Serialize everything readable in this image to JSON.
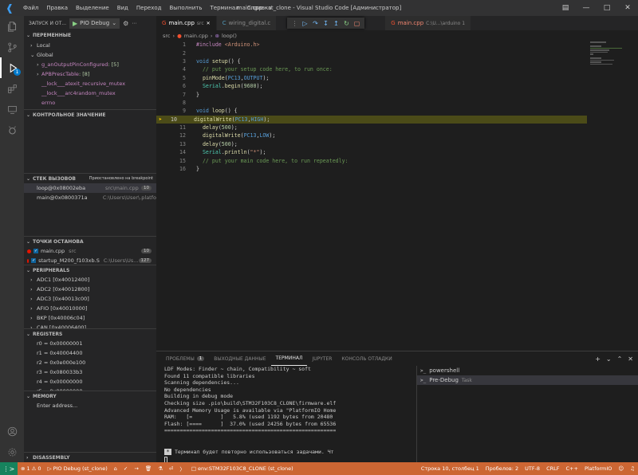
{
  "window": {
    "title": "main.cpp - st_clone - Visual Studio Code [Администратор]",
    "menu": [
      "Файл",
      "Правка",
      "Выделение",
      "Вид",
      "Переход",
      "Выполнить",
      "Терминал",
      "Справка"
    ]
  },
  "sidebar": {
    "run_label": "ЗАПУСК И ОТ...",
    "debug_config": "PIO Debug",
    "variables": {
      "title": "ПЕРЕМЕННЫЕ",
      "local": "Local",
      "global": "Global",
      "items": [
        {
          "name": "g_anOutputPinConfigured",
          "value": ": [5]"
        },
        {
          "name": "APBPrescTable",
          "value": ": [8]"
        },
        {
          "name": "__lock___atexit_recursive_mutex",
          "value": ""
        },
        {
          "name": "__lock___arc4random_mutex",
          "value": ""
        },
        {
          "name": "errno",
          "value": ""
        }
      ]
    },
    "watch": {
      "title": "КОНТРОЛЬНОЕ ЗНАЧЕНИЕ"
    },
    "callstack": {
      "title": "СТЕК ВЫЗОВОВ",
      "status": "Приостановлено на breakpoint",
      "frames": [
        {
          "fn": "loop@0x08002eba",
          "file": "src\\main.cpp",
          "line": "10"
        },
        {
          "fn": "main@0x0800371a",
          "file": "C:\\Users\\User\\.platfo",
          "line": ""
        }
      ]
    },
    "breakpoints": {
      "title": "ТОЧКИ ОСТАНОВА",
      "items": [
        {
          "file": "main.cpp",
          "dir": "src",
          "line": "10"
        },
        {
          "file": "startup_M200_f103xb.S",
          "dir": "C:\\Users\\Us...",
          "line": "127"
        }
      ]
    },
    "peripherals": {
      "title": "PERIPHERALS",
      "items": [
        "ADC1 [0x40012400]",
        "ADC2 [0x40012800]",
        "ADC3 [0x40013c00]",
        "AFIO [0x40010000]",
        "BKP [0x40006c04]",
        "CAN [0x40006400]"
      ]
    },
    "registers": {
      "title": "REGISTERS",
      "items": [
        "r0 = 0x00000001",
        "r1 = 0x40004400",
        "r2 = 0x0e000e100",
        "r3 = 0x080033b3",
        "r4 = 0x00000000",
        "r5 = 0x00000000"
      ]
    },
    "memory": {
      "title": "MEMORY",
      "placeholder": "Enter address..."
    },
    "disassembly": {
      "title": "DISASSEMBLY"
    }
  },
  "tabs": [
    {
      "label": "main.cpp",
      "desc": "src",
      "active": true
    },
    {
      "label": "wiring_digital.c",
      "desc": "",
      "active": false
    },
    {
      "label": "main.cpp",
      "desc": "C:\\U...\\arduino 1",
      "active": false
    }
  ],
  "breadcrumb": {
    "folder": "src",
    "file": "main.cpp",
    "symbol": "loop()"
  },
  "code": [
    {
      "n": "1",
      "html": "<span class='m'>#include</span> <span class='s'>&lt;Arduino.h&gt;</span>"
    },
    {
      "n": "2",
      "html": ""
    },
    {
      "n": "3",
      "html": "<span class='k'>void</span> <span class='f'>setup</span>() {"
    },
    {
      "n": "4",
      "html": "  <span class='c'>// put your setup code here, to run once:</span>"
    },
    {
      "n": "5",
      "html": "  <span class='f'>pinMode</span>(<span class='mc'>PC13</span>,<span class='mc'>OUTPUT</span>);"
    },
    {
      "n": "6",
      "html": "  <span class='t'>Serial</span>.<span class='f'>begin</span>(<span class='n'>9600</span>);"
    },
    {
      "n": "7",
      "html": "}"
    },
    {
      "n": "8",
      "html": ""
    },
    {
      "n": "9",
      "html": "<span class='k'>void</span> <span class='f'>loop</span>() {"
    },
    {
      "n": "10",
      "html": "  <span class='f'>digitalWrite</span>(<span class='mc'>PC13</span>,<span class='mc'>HIGH</span>);",
      "hl": true
    },
    {
      "n": "11",
      "html": "  <span class='f'>delay</span>(<span class='n'>500</span>);"
    },
    {
      "n": "12",
      "html": "  <span class='f'>digitalWrite</span>(<span class='mc'>PC13</span>,<span class='mc'>LOW</span>);"
    },
    {
      "n": "13",
      "html": "  <span class='f'>delay</span>(<span class='n'>500</span>);"
    },
    {
      "n": "14",
      "html": "  <span class='t'>Serial</span>.<span class='f'>println</span>(<span class='s'>\"*\"</span>);"
    },
    {
      "n": "15",
      "html": "  <span class='c'>// put your main code here, to run repeatedly:</span>"
    },
    {
      "n": "16",
      "html": "}"
    }
  ],
  "panel": {
    "tabs": [
      {
        "label": "ПРОБЛЕМЫ",
        "badge": "1"
      },
      {
        "label": "ВЫХОДНЫЕ ДАННЫЕ",
        "badge": ""
      },
      {
        "label": "ТЕРМИНАЛ",
        "badge": "",
        "active": true
      },
      {
        "label": "JUPYTER",
        "badge": ""
      },
      {
        "label": "КОНСОЛЬ ОТЛАДКИ",
        "badge": ""
      }
    ],
    "terminal_lines": [
      "LDF Modes: Finder ~ chain, Compatibility ~ soft",
      "Found 11 compatible libraries",
      "Scanning dependencies...",
      "No dependencies",
      "Building in debug mode",
      "Checking size .pio\\build\\STM32F103C8_CLONE\\firmware.elf",
      "Advanced Memory Usage is available via \"PlatformIO Home",
      "RAM:   [=         ]   5.8% (used 1192 bytes from 20480",
      "Flash: [====      ]  37.0% (used 24256 bytes from 65536",
      "======================================================="
    ],
    "notice": "Терминал будет повторно использоваться задачами. Чт",
    "terminals": [
      {
        "name": "powershell",
        "task": ""
      },
      {
        "name": "Pre-Debug",
        "task": "Task"
      }
    ]
  },
  "status": {
    "errors": "1",
    "warnings": "0",
    "debug": "PIO Debug (st_clone)",
    "env": "env:STM32F103C8_CLONE (st_clone)",
    "position": "Строка 10, столбец 1",
    "spaces": "Пробелов: 2",
    "encoding": "UTF-8",
    "eol": "CRLF",
    "language": "C++",
    "platform": "PlatformIO"
  }
}
